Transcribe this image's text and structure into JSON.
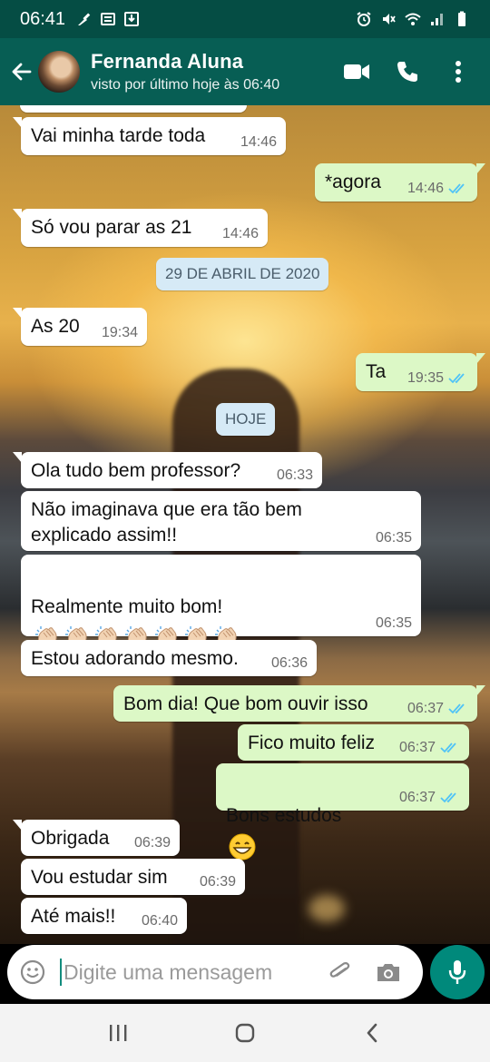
{
  "status_bar": {
    "time": "06:41",
    "left_icons": [
      "cleaning-icon",
      "sim-card-icon",
      "download-icon"
    ],
    "right_icons": [
      "alarm-icon",
      "mute-icon",
      "wifi-icon",
      "signal-icon",
      "battery-icon"
    ]
  },
  "header": {
    "contact_name": "Fernanda Aluna",
    "status": "visto por último hoje às 06:40",
    "actions": [
      "video-call-icon",
      "voice-call-icon",
      "more-options-icon"
    ]
  },
  "messages": [
    {
      "dir": "in",
      "text": "Vai minha tarde toda",
      "time": "14:46"
    },
    {
      "dir": "out",
      "text": "*agora",
      "time": "14:46",
      "read": true
    },
    {
      "dir": "in",
      "text": "Só vou parar as 21",
      "time": "14:46"
    },
    {
      "dir": "date",
      "text": "29 DE ABRIL DE 2020"
    },
    {
      "dir": "in",
      "text": "As 20",
      "time": "19:34"
    },
    {
      "dir": "out",
      "text": "Ta",
      "time": "19:35",
      "read": true
    },
    {
      "dir": "date",
      "text": "HOJE"
    },
    {
      "dir": "in",
      "text": "Ola tudo bem professor?",
      "time": "06:33"
    },
    {
      "dir": "in",
      "text": "Não imaginava que era tão bem\nexplicado assim!!",
      "time": "06:35"
    },
    {
      "dir": "in",
      "text": "Realmente muito bom!",
      "time": "06:35",
      "emoji": "clapping-hands-emoji",
      "emoji_count": 7
    },
    {
      "dir": "in",
      "text": "Estou adorando mesmo.",
      "time": "06:36"
    },
    {
      "dir": "out",
      "text": "Bom dia! Que bom ouvir isso",
      "time": "06:37",
      "read": true
    },
    {
      "dir": "out",
      "text": "Fico muito feliz",
      "time": "06:37",
      "read": true
    },
    {
      "dir": "out",
      "text": "Bons estudos",
      "time": "06:37",
      "read": true,
      "emoji": "grinning-face-emoji"
    },
    {
      "dir": "in",
      "text": "Obrigada",
      "time": "06:39"
    },
    {
      "dir": "in",
      "text": "Vou estudar sim",
      "time": "06:39"
    },
    {
      "dir": "in",
      "text": "Até mais!!",
      "time": "06:40"
    }
  ],
  "composer": {
    "placeholder": "Digite uma mensagem",
    "icons": [
      "emoji-icon",
      "attach-icon",
      "camera-icon",
      "mic-icon"
    ]
  },
  "nav_bar": [
    "recents-icon",
    "home-icon",
    "back-icon"
  ],
  "colors": {
    "header": "#075e54",
    "status_bar": "#054d44",
    "bubble_out": "#dcf8c6",
    "bubble_in": "#ffffff",
    "read_tick": "#4fc3f7",
    "mic": "#00897b",
    "date_pill": "#d6eaf6"
  }
}
